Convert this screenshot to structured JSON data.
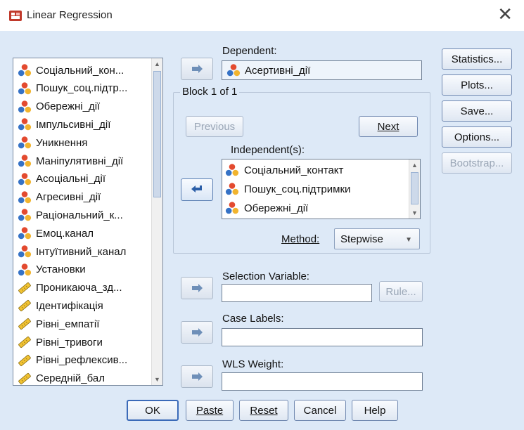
{
  "window": {
    "title": "Linear Regression"
  },
  "variables": [
    {
      "label": "Соціальний_кон...",
      "icon": "nominal-icon"
    },
    {
      "label": "Пошук_соц.підтр...",
      "icon": "nominal-icon"
    },
    {
      "label": "Обережні_дії",
      "icon": "nominal-icon"
    },
    {
      "label": "Імпульсивні_дії",
      "icon": "nominal-icon"
    },
    {
      "label": "Уникнення",
      "icon": "nominal-icon"
    },
    {
      "label": "Маніпулятивні_дії",
      "icon": "nominal-icon"
    },
    {
      "label": "Асоціальні_дії",
      "icon": "nominal-icon"
    },
    {
      "label": "Агресивні_дії",
      "icon": "nominal-icon"
    },
    {
      "label": "Раціональний_к...",
      "icon": "nominal-icon"
    },
    {
      "label": "Емоц.канал",
      "icon": "nominal-icon"
    },
    {
      "label": "Інтуїтивний_канал",
      "icon": "nominal-icon"
    },
    {
      "label": "Установки",
      "icon": "nominal-icon"
    },
    {
      "label": "Проникаюча_зд...",
      "icon": "scale-icon"
    },
    {
      "label": "Ідентифікація",
      "icon": "scale-icon"
    },
    {
      "label": "Рівні_емпатії",
      "icon": "scale-icon"
    },
    {
      "label": "Рівні_тривоги",
      "icon": "scale-icon"
    },
    {
      "label": "Рівні_рефлексив...",
      "icon": "scale-icon"
    },
    {
      "label": "Середній_бал",
      "icon": "scale-icon"
    }
  ],
  "dependent": {
    "label": "Dependent:",
    "value": "Асертивні_дії"
  },
  "block": {
    "label": "Block 1 of 1",
    "previous_label": "Previous",
    "next_label": "Next",
    "independent_label": "Independent(s):",
    "independents": [
      "Соціальний_контакт",
      "Пошук_соц.підтримки",
      "Обережні_дії"
    ],
    "method_label": "Method:",
    "method_value": "Stepwise"
  },
  "selection": {
    "label": "Selection Variable:",
    "rule_label": "Rule..."
  },
  "case_labels": {
    "label": "Case Labels:"
  },
  "wls": {
    "label": "WLS Weight:"
  },
  "side_buttons": {
    "statistics": "Statistics...",
    "plots": "Plots...",
    "save": "Save...",
    "options": "Options...",
    "bootstrap": "Bootstrap..."
  },
  "footer": {
    "ok": "OK",
    "paste": "Paste",
    "reset": "Reset",
    "cancel": "Cancel",
    "help": "Help"
  },
  "colors": {
    "background": "#dde9f7",
    "border": "#7088b0",
    "accent": "#3b6ab8"
  }
}
